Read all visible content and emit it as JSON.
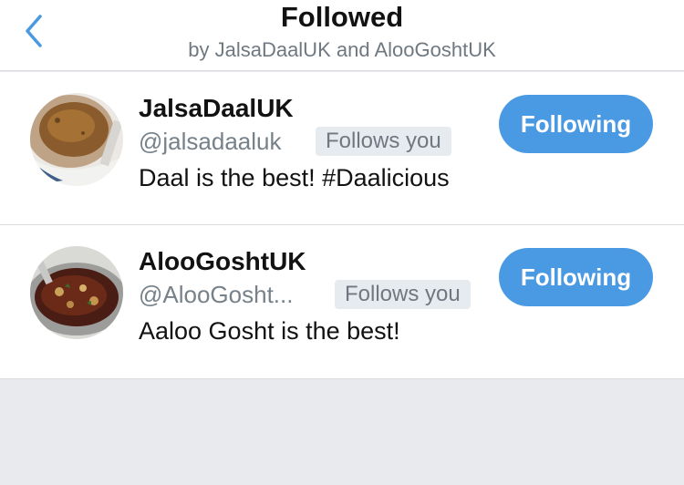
{
  "header": {
    "back_icon": "chevron-left-icon",
    "title": "Followed",
    "subtitle": "by JalsaDaalUK and AlooGoshtUK"
  },
  "accent_color": "#4a9ae3",
  "users": [
    {
      "name": "JalsaDaalUK",
      "handle": "@jalsadaaluk",
      "follows_you": "Follows you",
      "bio": "Daal is the best! #Daalicious",
      "button_label": "Following",
      "avatar_icon": "daal-bowl-avatar"
    },
    {
      "name": "AlooGoshtUK",
      "handle": "@AlooGosht...",
      "follows_you": "Follows you",
      "bio": "Aaloo Gosht is the best!",
      "button_label": "Following",
      "avatar_icon": "aloo-gosht-pot-avatar"
    }
  ]
}
